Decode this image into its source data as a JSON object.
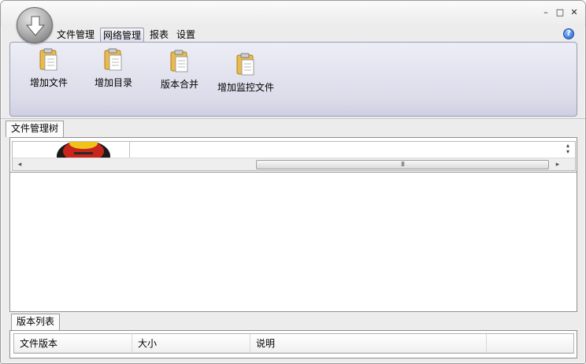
{
  "window": {
    "controls": {
      "minimize": "–",
      "maximize": "□",
      "close": "✕"
    }
  },
  "orb": {
    "icon": "download-arrow-icon"
  },
  "ribbon_tabs": [
    {
      "label": "文件管理",
      "active": false
    },
    {
      "label": "网络管理",
      "active": true
    },
    {
      "label": "报表",
      "active": false
    },
    {
      "label": "设置",
      "active": false
    }
  ],
  "help": {
    "glyph": "?"
  },
  "ribbon_buttons": [
    {
      "label": "增加文件",
      "icon": "clipboard-icon"
    },
    {
      "label": "增加目录",
      "icon": "clipboard-icon"
    },
    {
      "label": "版本合并",
      "icon": "clipboard-icon"
    },
    {
      "label": "增加监控文件",
      "icon": "clipboard-icon"
    }
  ],
  "tree_panel": {
    "tab_label": "文件管理树"
  },
  "scrollbar": {
    "left_arrow": "◂",
    "right_arrow": "▸",
    "grip": "III",
    "up_arrow": "▴",
    "down_arrow": "▾"
  },
  "version_panel": {
    "tab_label": "版本列表",
    "columns": [
      "文件版本",
      "大小",
      "说明",
      ""
    ]
  },
  "colors": {
    "ribbon_bg": "#dcdcea",
    "ribbon_border": "#9b9bb8",
    "clipboard_body": "#e7b84a",
    "help_blue": "#1f5fc9"
  }
}
